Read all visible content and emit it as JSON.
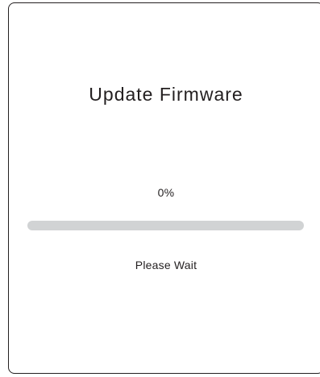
{
  "dialog": {
    "title": "Update Firmware",
    "progress_text": "0%",
    "progress_value": 0,
    "status_text": "Please Wait"
  },
  "colors": {
    "text": "#231f20",
    "track": "#d1d3d4",
    "background": "#ffffff"
  }
}
